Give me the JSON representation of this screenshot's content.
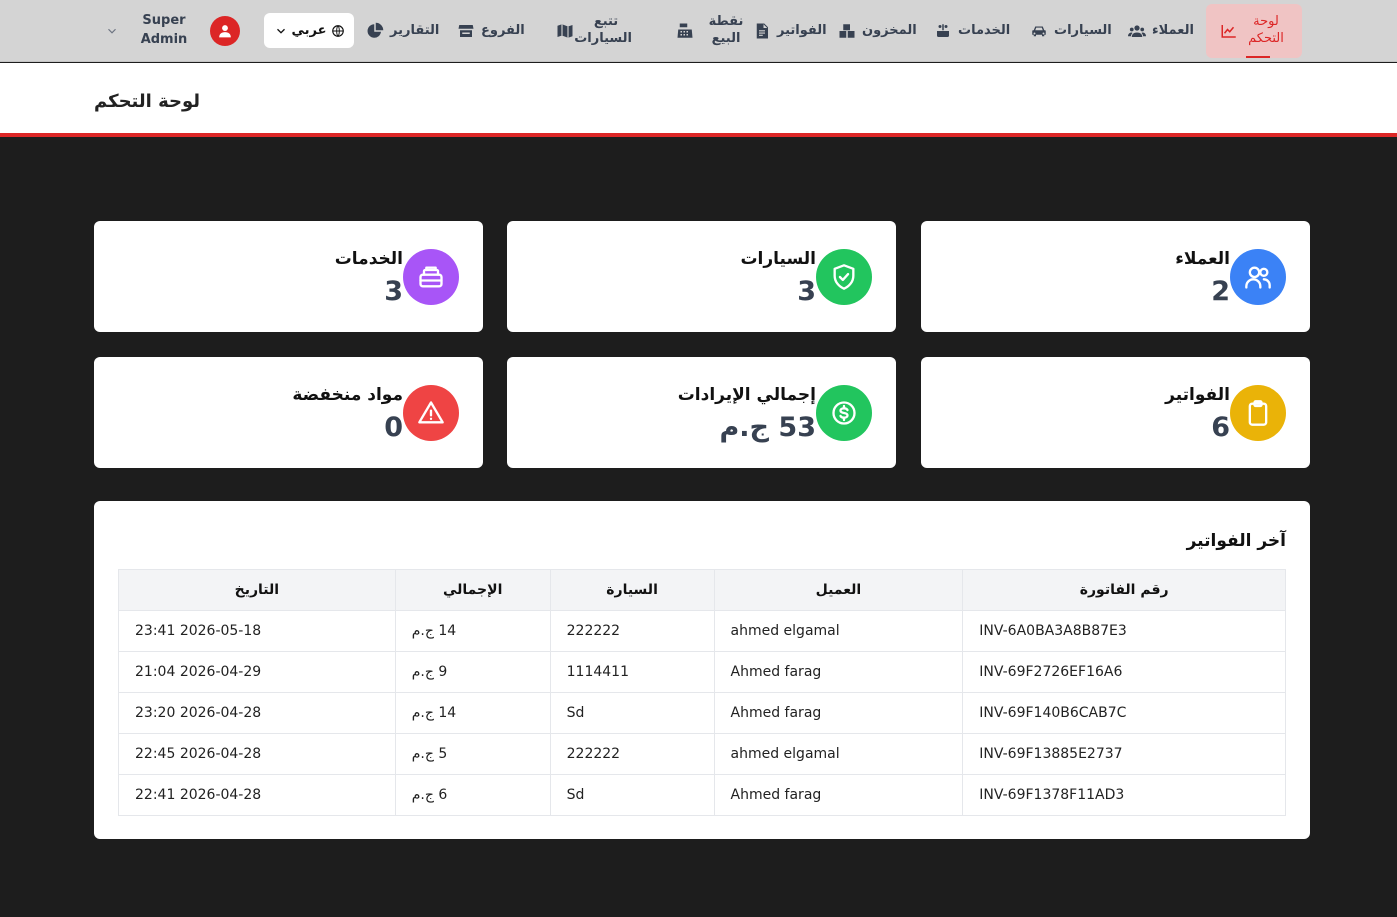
{
  "nav": {
    "dashboard": "لوحة التحكم",
    "customers": "العملاء",
    "cars": "السيارات",
    "services": "الخدمات",
    "inventory": "المخزون",
    "invoices": "الفواتير",
    "pos": "نقطة البيع",
    "car_tracking": "تتبع السيارات",
    "branches": "الفروع",
    "reports": "التقارير",
    "language": "عربي",
    "user_name": "Super Admin"
  },
  "header": {
    "title": "لوحة التحكم"
  },
  "stats": [
    {
      "label": "العملاء",
      "value": "2",
      "color": "#3b82f6",
      "icon": "users-icon"
    },
    {
      "label": "السيارات",
      "value": "3",
      "color": "#22c55e",
      "icon": "shield-check-icon"
    },
    {
      "label": "الخدمات",
      "value": "3",
      "color": "#a855f7",
      "icon": "stack-icon"
    },
    {
      "label": "الفواتير",
      "value": "6",
      "color": "#eab308",
      "icon": "clipboard-icon"
    },
    {
      "label": "إجمالي الإيرادات",
      "value": "53 ج.م",
      "color": "#22c55e",
      "icon": "dollar-icon"
    },
    {
      "label": "مواد منخفضة",
      "value": "0",
      "color": "#ef4444",
      "icon": "warning-icon"
    }
  ],
  "invoices": {
    "title": "آخر الفواتير",
    "columns": [
      "رقم الفاتورة",
      "العميل",
      "السيارة",
      "الإجمالي",
      "التاريخ"
    ],
    "rows": [
      [
        "INV-6A0BA3A8B87E3",
        "ahmed elgamal",
        "222222",
        "14 ج.م",
        "2026-05-18 23:41"
      ],
      [
        "INV-69F2726EF16A6",
        "Ahmed farag",
        "1114411",
        "9 ج.م",
        "2026-04-29 21:04"
      ],
      [
        "INV-69F140B6CAB7C",
        "Ahmed farag",
        "Sd",
        "14 ج.م",
        "2026-04-28 23:20"
      ],
      [
        "INV-69F13885E2737",
        "ahmed elgamal",
        "222222",
        "5 ج.م",
        "2026-04-28 22:45"
      ],
      [
        "INV-69F1378F11AD3",
        "Ahmed farag",
        "Sd",
        "6 ج.م",
        "2026-04-28 22:41"
      ]
    ]
  }
}
